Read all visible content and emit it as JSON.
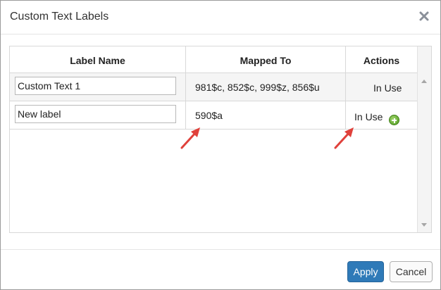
{
  "dialog": {
    "title": "Custom Text Labels",
    "close_icon": "close-x-icon"
  },
  "table": {
    "headers": [
      "Label Name",
      "Mapped To",
      "Actions"
    ],
    "rows": [
      {
        "label": "Custom Text 1",
        "mapped_to": "981$c, 852$c, 999$z, 856$u",
        "action": "In Use"
      },
      {
        "label": "New label",
        "mapped_to": "590$a",
        "action": "In Use",
        "add_icon": "plus-circle-icon"
      }
    ]
  },
  "annotations": {
    "arrow_color": "#e0413b",
    "icon": "red-arrow-icon"
  },
  "footer": {
    "apply_label": "Apply",
    "cancel_label": "Cancel"
  },
  "colors": {
    "primary": "#2f7ab8",
    "add_green": "#4d9a1e",
    "row_alt": "#f5f5f5"
  }
}
